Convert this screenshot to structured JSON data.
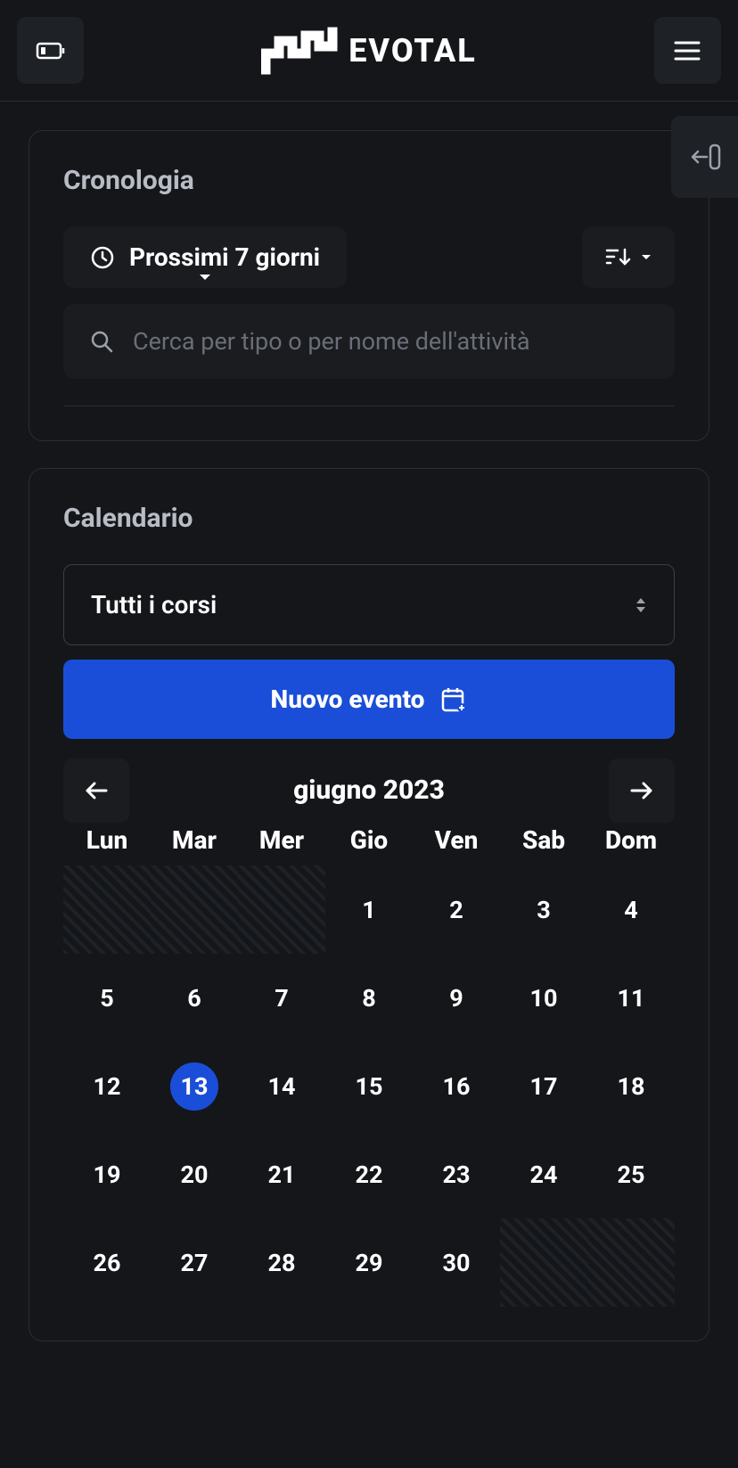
{
  "header": {
    "brand": "EVOTAL"
  },
  "timeline": {
    "title": "Cronologia",
    "range_label": "Prossimi 7 giorni",
    "search_placeholder": "Cerca per tipo o per nome dell'attività"
  },
  "calendar": {
    "title": "Calendario",
    "course_filter": "Tutti i corsi",
    "new_event_label": "Nuovo evento",
    "month_label": "giugno 2023",
    "day_headers": [
      "Lun",
      "Mar",
      "Mer",
      "Gio",
      "Ven",
      "Sab",
      "Dom"
    ],
    "weeks": [
      [
        {
          "d": "",
          "disabled": true
        },
        {
          "d": "",
          "disabled": true
        },
        {
          "d": "",
          "disabled": true
        },
        {
          "d": "1"
        },
        {
          "d": "2"
        },
        {
          "d": "3"
        },
        {
          "d": "4"
        }
      ],
      [
        {
          "d": "5"
        },
        {
          "d": "6"
        },
        {
          "d": "7"
        },
        {
          "d": "8"
        },
        {
          "d": "9"
        },
        {
          "d": "10"
        },
        {
          "d": "11"
        }
      ],
      [
        {
          "d": "12"
        },
        {
          "d": "13",
          "today": true
        },
        {
          "d": "14"
        },
        {
          "d": "15"
        },
        {
          "d": "16"
        },
        {
          "d": "17"
        },
        {
          "d": "18"
        }
      ],
      [
        {
          "d": "19"
        },
        {
          "d": "20"
        },
        {
          "d": "21"
        },
        {
          "d": "22"
        },
        {
          "d": "23"
        },
        {
          "d": "24"
        },
        {
          "d": "25"
        }
      ],
      [
        {
          "d": "26"
        },
        {
          "d": "27"
        },
        {
          "d": "28"
        },
        {
          "d": "29"
        },
        {
          "d": "30"
        },
        {
          "d": "",
          "disabled": true
        },
        {
          "d": "",
          "disabled": true
        }
      ]
    ]
  }
}
